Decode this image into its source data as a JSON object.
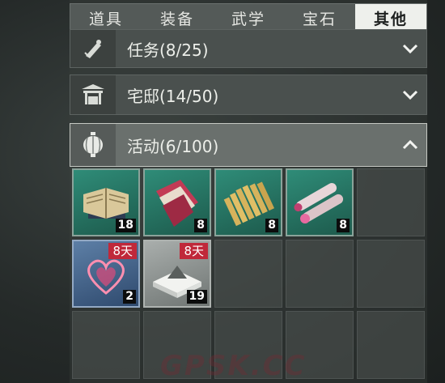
{
  "tabs": [
    {
      "label": "道具",
      "active": false
    },
    {
      "label": "装备",
      "active": false
    },
    {
      "label": "武学",
      "active": false
    },
    {
      "label": "宝石",
      "active": false
    },
    {
      "label": "其他",
      "active": true
    }
  ],
  "categories": [
    {
      "label": "任务(8/25)",
      "icon": "scroll-icon",
      "expanded": false
    },
    {
      "label": "宅邸(14/50)",
      "icon": "gate-icon",
      "expanded": false
    },
    {
      "label": "活动(6/100)",
      "icon": "lantern-icon",
      "expanded": true
    }
  ],
  "items": [
    {
      "name": "book-stack",
      "count": "18",
      "badge": ""
    },
    {
      "name": "red-book",
      "count": "8",
      "badge": ""
    },
    {
      "name": "bamboo-slips",
      "count": "8",
      "badge": ""
    },
    {
      "name": "scroll-bundle",
      "count": "8",
      "badge": ""
    },
    {
      "name": "heart-charm",
      "count": "2",
      "badge": "8天"
    },
    {
      "name": "paper-bundle",
      "count": "19",
      "badge": "8天"
    }
  ],
  "watermark": "GPSK.CC",
  "colors": {
    "accent_badge": "#c0283a",
    "item_green": "#2f8c78"
  }
}
